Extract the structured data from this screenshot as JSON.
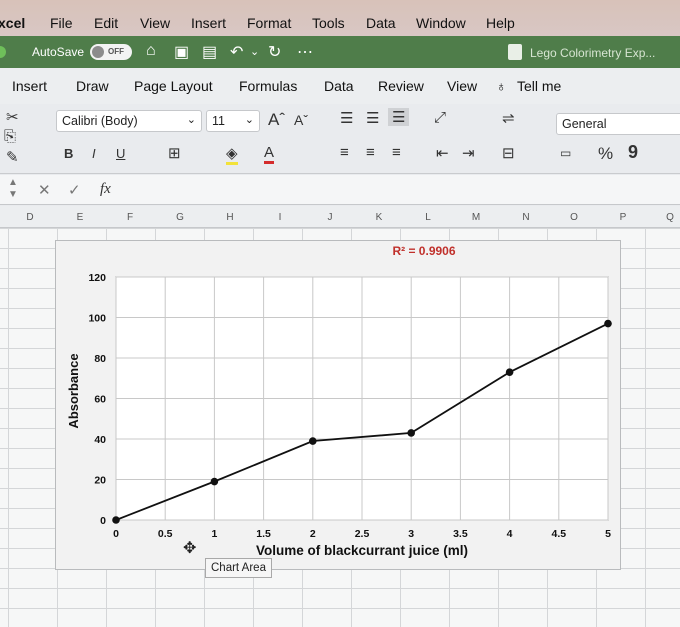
{
  "menubar": {
    "app": "xcel",
    "items": [
      "File",
      "Edit",
      "View",
      "Insert",
      "Format",
      "Tools",
      "Data",
      "Window",
      "Help"
    ]
  },
  "titlebar": {
    "autosave_label": "AutoSave",
    "autosave_state": "OFF",
    "document_name": "Lego Colorimetry Exp..."
  },
  "ribbon_tabs": [
    "Insert",
    "Draw",
    "Page Layout",
    "Formulas",
    "Data",
    "Review",
    "View",
    "Tell me"
  ],
  "ribbon": {
    "font_name": "Calibri (Body)",
    "font_size": "11",
    "number_format": "General",
    "bold": "B",
    "italic": "I",
    "underline": "U",
    "percent": "%",
    "comma": "9"
  },
  "formula_bar": {
    "fx": "fx"
  },
  "columns": [
    "D",
    "E",
    "F",
    "G",
    "H",
    "I",
    "J",
    "K",
    "L",
    "M",
    "N",
    "O",
    "P",
    "Q"
  ],
  "chart": {
    "tooltip": "Chart Area",
    "trendline_label": "R² = 0.9906",
    "colors": {
      "series": "#111111",
      "r2": "#c0302b",
      "plot_bg": "#ffffff"
    }
  },
  "chart_data": {
    "type": "scatter",
    "x": [
      0,
      1,
      2,
      3,
      4,
      5
    ],
    "series": [
      {
        "values": [
          0,
          19,
          39,
          43,
          73,
          97
        ]
      }
    ],
    "xlabel": "Volume of blackcurrant juice (ml)",
    "ylabel": "Absorbance",
    "xlim": [
      0,
      5
    ],
    "ylim": [
      0,
      120
    ],
    "xticks": [
      "0",
      "0.5",
      "1",
      "1.5",
      "2",
      "2.5",
      "3",
      "3.5",
      "4",
      "4.5",
      "5"
    ],
    "yticks": [
      "0",
      "20",
      "40",
      "60",
      "80",
      "100",
      "120"
    ],
    "grid": true,
    "lines_connected": true
  }
}
